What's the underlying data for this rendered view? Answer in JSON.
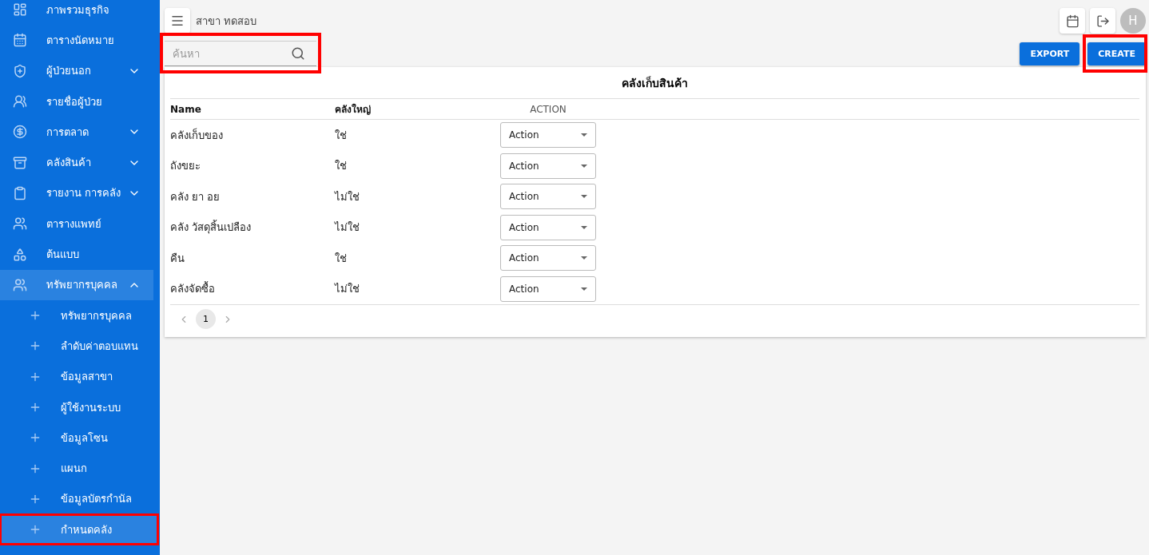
{
  "sidebar": {
    "items": [
      {
        "label": "ภาพรวมธุรกิจ"
      },
      {
        "label": "ตารางนัดหมาย"
      },
      {
        "label": "ผู้ป่วยนอก",
        "expanded": false
      },
      {
        "label": "รายชื่อผู้ป่วย"
      },
      {
        "label": "การตลาด",
        "expanded": false
      },
      {
        "label": "คลังสินค้า",
        "expanded": false
      },
      {
        "label": "รายงาน การคลัง",
        "expanded": false
      },
      {
        "label": "ตารางแพทย์"
      },
      {
        "label": "ต้นแบบ"
      },
      {
        "label": "ทรัพยากรบุคคล",
        "expanded": true,
        "children": [
          {
            "label": "ทรัพยากรบุคคล",
            "selected": false,
            "highlighted": false
          },
          {
            "label": "ลำดับค่าตอบแทน",
            "selected": false,
            "highlighted": false
          },
          {
            "label": "ข้อมูลสาขา",
            "selected": false,
            "highlighted": false
          },
          {
            "label": "ผู้ใช้งานระบบ",
            "selected": false,
            "highlighted": false
          },
          {
            "label": "ข้อมูลโซน",
            "selected": false,
            "highlighted": false
          },
          {
            "label": "แผนก",
            "selected": false,
            "highlighted": false
          },
          {
            "label": "ข้อมูลบัตรกำนัล",
            "selected": false,
            "highlighted": false
          },
          {
            "label": "กำหนดคลัง",
            "selected": true,
            "highlighted": true
          }
        ]
      }
    ]
  },
  "header": {
    "branch": "สาขา ทดสอบ",
    "avatar": "H"
  },
  "search": {
    "placeholder": "ค้นหา",
    "highlighted": true
  },
  "buttons": [
    {
      "label": "EXPORT",
      "highlighted": false
    },
    {
      "label": "CREATE",
      "highlighted": true
    }
  ],
  "table": {
    "title": "คลังเก็บสินค้า",
    "columns": [
      "Name",
      "คลังใหญ่",
      "ACTION"
    ],
    "rows": [
      {
        "name": "คลังเก็บของ",
        "main": "ใช่",
        "action": "Action"
      },
      {
        "name": "ถังขยะ",
        "main": "ใช่",
        "action": "Action"
      },
      {
        "name": "คลัง ยา อย",
        "main": "ไม่ใช่",
        "action": "Action"
      },
      {
        "name": "คลัง วัสดุสิ้นเปลือง",
        "main": "ไม่ใช่",
        "action": "Action"
      },
      {
        "name": "คืน",
        "main": "ใช่",
        "action": "Action"
      },
      {
        "name": "คลังจัดซื้อ",
        "main": "ไม่ใช่",
        "action": "Action"
      }
    ]
  },
  "pagination": {
    "pages": [
      {
        "label": "1",
        "selected": true
      }
    ]
  }
}
